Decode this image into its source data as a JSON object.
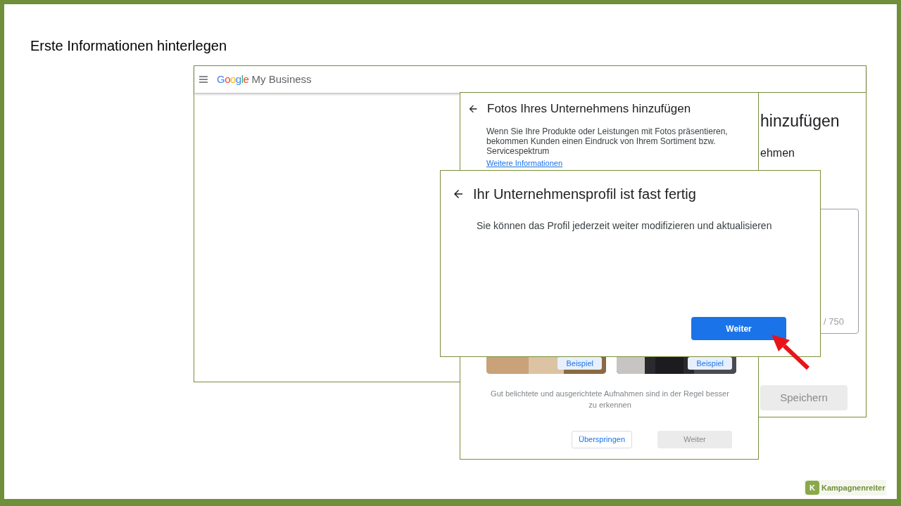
{
  "slide": {
    "title": "Erste Informationen hinterlegen",
    "logo": {
      "mark": "K",
      "name": "Kampagnenreiter"
    }
  },
  "app_header": {
    "brand": "Google",
    "product": "My Business"
  },
  "background_page": {
    "heading": "hinzufügen",
    "subheading": "ehmen",
    "counter": "/ 750",
    "save_button": {
      "label": "Speichern",
      "disabled": true
    }
  },
  "photos_dialog": {
    "title": "Fotos Ihres Unternehmens hinzufügen",
    "description": "Wenn Sie Ihre Produkte oder Leistungen mit Fotos präsentieren, bekommen Kunden einen Eindruck von Ihrem Sortiment bzw. Servicespektrum",
    "link": "Weitere Informationen",
    "examples": [
      {
        "badge": "Beispiel"
      },
      {
        "badge": "Beispiel"
      }
    ],
    "hint": "Gut belichtete und ausgerichtete Aufnahmen sind in der Regel besser zu erkennen",
    "buttons": [
      {
        "label": "Überspringen",
        "kind": "outline"
      },
      {
        "label": "Weiter",
        "kind": "disabled"
      }
    ]
  },
  "finish_dialog": {
    "title": "Ihr Unternehmensprofil ist fast fertig",
    "description": "Sie können das Profil jederzeit weiter modifizieren und aktualisieren",
    "button": {
      "label": "Weiter"
    }
  }
}
